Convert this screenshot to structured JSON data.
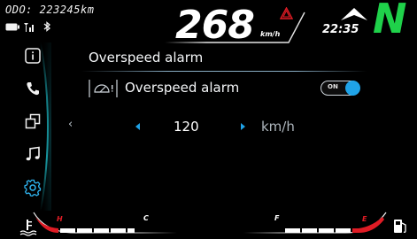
{
  "status": {
    "odometer": "ODO: 223245km",
    "speed": "268",
    "speed_unit": "km/h",
    "time": "22:35",
    "gear": "N"
  },
  "sidebar": {
    "items": [
      {
        "icon": "info-icon"
      },
      {
        "icon": "phone-icon"
      },
      {
        "icon": "windows-icon"
      },
      {
        "icon": "music-icon"
      },
      {
        "icon": "settings-icon",
        "active": true
      }
    ]
  },
  "main": {
    "title": "Overspeed alarm",
    "alarm": {
      "label": "Overspeed alarm",
      "toggle_text": "ON",
      "enabled": true
    },
    "threshold": {
      "value": "120",
      "unit": "km/h"
    }
  },
  "gauges": {
    "temp_high": "H",
    "temp_low": "C",
    "fuel_full": "F",
    "fuel_empty": "E"
  },
  "colors": {
    "accent": "#1fa3e8",
    "gear": "#1fd14a",
    "warning": "#e01c25",
    "sidebar_glow": "#1aa6b0"
  }
}
